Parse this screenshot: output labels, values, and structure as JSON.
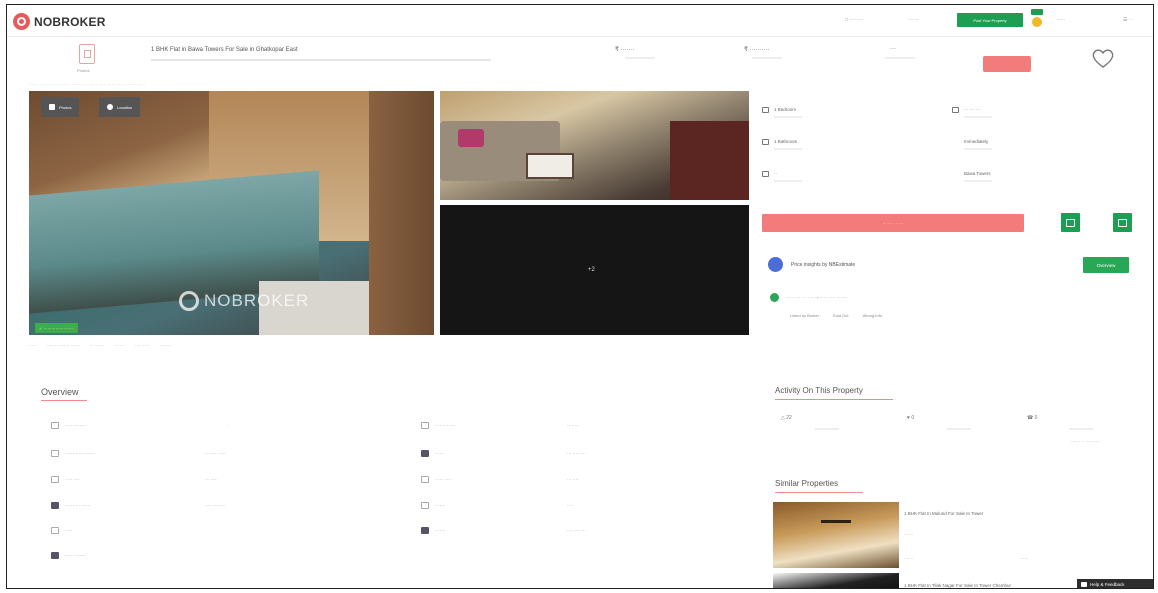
{
  "header": {
    "brand": "NOBROKER",
    "post_property": "Post Your Property"
  },
  "property": {
    "photo_caption": "Photos",
    "title": "1 BHK Flat in Bawa Towers For Sale in Ghatkopar East",
    "beds": "1 Bedroom",
    "baths": "1 Bathroom",
    "available_label": "Immediately",
    "location_label": "Bawa Towers"
  },
  "gallery": {
    "photos_btn": "Photos",
    "location_btn": "Location",
    "watermark": "NOBROKER",
    "more_count": "+2"
  },
  "contact": {
    "owner_check": "Price insights by NBEstimate",
    "overview_btn": "Overview",
    "report_links": [
      "Listed by Broker",
      "Sold Out",
      "Wrong Info"
    ]
  },
  "overview": {
    "title": "Overview"
  },
  "activity": {
    "title": "Activity On This Property",
    "views": "22",
    "shortlists": "0",
    "contacted": "0"
  },
  "similar": {
    "title": "Similar Properties",
    "item1_name": "1 BHK Flat In Mulund For Sale In Tower",
    "item2_name": "1 BHK Flat In Tilak Nagar For Sale In Tower Chembur"
  },
  "help": {
    "label": "Help & Feedback"
  },
  "colors": {
    "brand_red": "#e85a5a",
    "green": "#1e9e52",
    "cta_pink": "#f37b7b"
  }
}
